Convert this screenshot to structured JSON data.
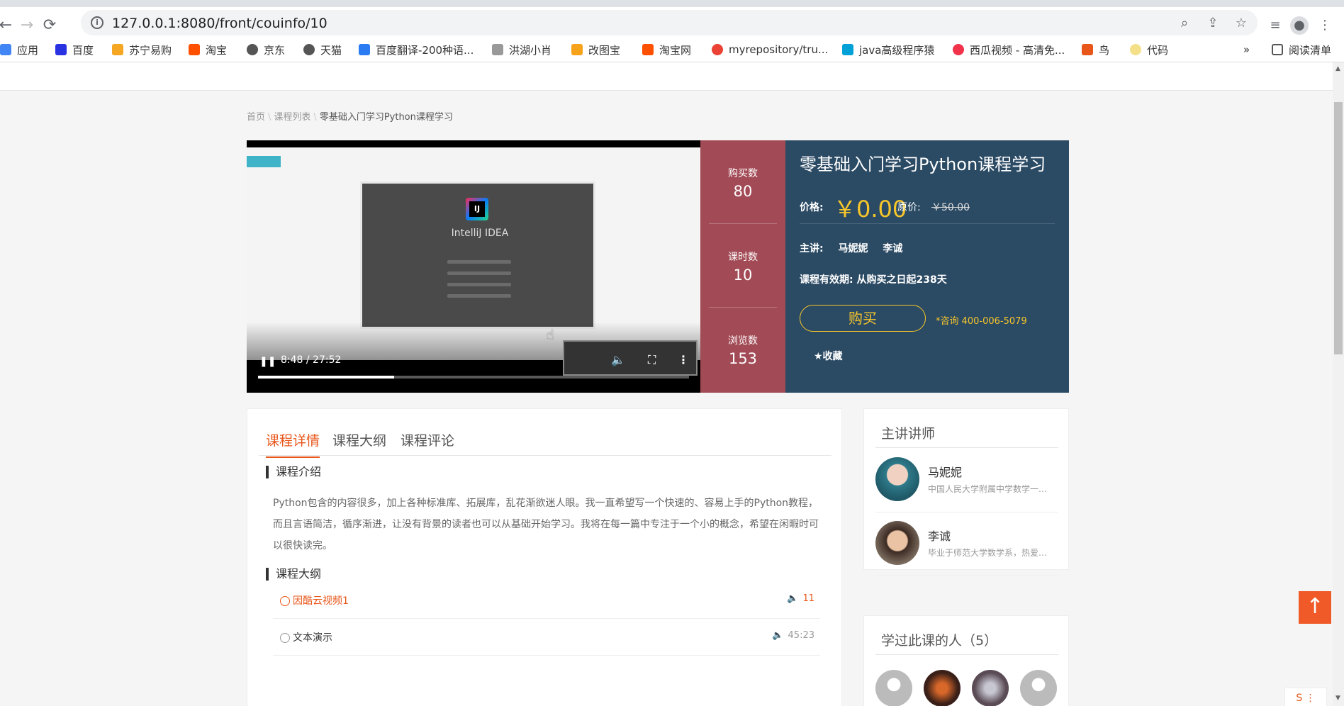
{
  "browser": {
    "url": "127.0.0.1:8080/front/couinfo/10",
    "info_glyph": "i",
    "back_glyph": "←",
    "forward_glyph": "→",
    "reload_glyph": "⟳",
    "icons": [
      "zoom-icon",
      "share-icon",
      "star-icon",
      "reading-list-icon",
      "profile-icon",
      "menu-icon"
    ],
    "bookmarks_more": "»",
    "reading_list": "阅读清单",
    "bookmarks": [
      {
        "label": "应用",
        "color": "#4285f4"
      },
      {
        "label": "百度",
        "color": "#2932e1"
      },
      {
        "label": "苏宁易购",
        "color": "#f5a623"
      },
      {
        "label": "淘宝",
        "color": "#ff5000"
      },
      {
        "label": "京东",
        "color": "#555555"
      },
      {
        "label": "天猫",
        "color": "#555555"
      },
      {
        "label": "百度翻译-200种语...",
        "color": "#2b7bf3"
      },
      {
        "label": "洪湖小肖",
        "color": "#999999"
      },
      {
        "label": "改图宝",
        "color": "#f7a21b"
      },
      {
        "label": "淘宝网",
        "color": "#ff5000"
      },
      {
        "label": "myrepository/tru...",
        "color": "#ea4335"
      },
      {
        "label": "java高级程序猿",
        "color": "#00a1d6"
      },
      {
        "label": "西瓜视频 - 高清免...",
        "color": "#f1324a"
      },
      {
        "label": "鸟",
        "color": "#e8561a"
      },
      {
        "label": "代码",
        "color": "#f5e08a"
      }
    ]
  },
  "breadcrumb": {
    "home": "首页",
    "list": "课程列表",
    "current": "零基础入门学习Python课程学习",
    "sep": "\\"
  },
  "video": {
    "time": "8:48 / 27:52",
    "progress": 0.316,
    "play_glyph": "❚❚",
    "volume_glyph": "🔈",
    "fullscreen_glyph": "⛶",
    "more_glyph": "⋮",
    "screen_product": "IntelliJ IDEA"
  },
  "stats": [
    {
      "label": "购买数",
      "value": "80"
    },
    {
      "label": "课时数",
      "value": "10"
    },
    {
      "label": "浏览数",
      "value": "153"
    }
  ],
  "course": {
    "title": "零基础入门学习Python课程学习",
    "price_label": "价格:",
    "price": "￥0.00",
    "orig_label": "原价:",
    "orig_price": "￥50.00",
    "teachers_label": "主讲:",
    "teacher_names": [
      "马妮妮",
      "李诚"
    ],
    "valid": "课程有效期:  从购买之日起238天",
    "buy": "购买",
    "consult": "*咨询 400-006-5079",
    "fav": "★收藏",
    "accent": "#f6c62b",
    "panel_color": "#2b4a64",
    "stats_color": "#a24a55"
  },
  "tabs": [
    {
      "label": "课程详情",
      "active": true
    },
    {
      "label": "课程大纲",
      "active": false
    },
    {
      "label": "课程评论",
      "active": false
    }
  ],
  "intro": {
    "title": "课程介绍",
    "text": "Python包含的内容很多，加上各种标准库、拓展库，乱花渐欲迷人眼。我一直希望写一个快速的、容易上手的Python教程，而且言语简洁，循序渐进，让没有背景的读者也可以从基础开始学习。我将在每一篇中专注于一个小的概念，希望在闲暇时可以很快读完。"
  },
  "outline": {
    "title": "课程大纲",
    "items": [
      {
        "name": "因酷云视频1",
        "duration": "11",
        "active": true
      },
      {
        "name": "文本演示",
        "duration": "45:23",
        "active": false
      }
    ],
    "speaker_glyph": "🔈"
  },
  "teachers_card": {
    "title": "主讲讲师",
    "items": [
      {
        "name": "马妮妮",
        "desc": "中国人民大学附属中学数学一级教师"
      },
      {
        "name": "李诚",
        "desc": "毕业于师范大学数学系，热爱教育事业"
      }
    ]
  },
  "learners_card": {
    "title": "学过此课的人（5）"
  },
  "scroll_top": "↑",
  "float_widget": "S ⋮"
}
